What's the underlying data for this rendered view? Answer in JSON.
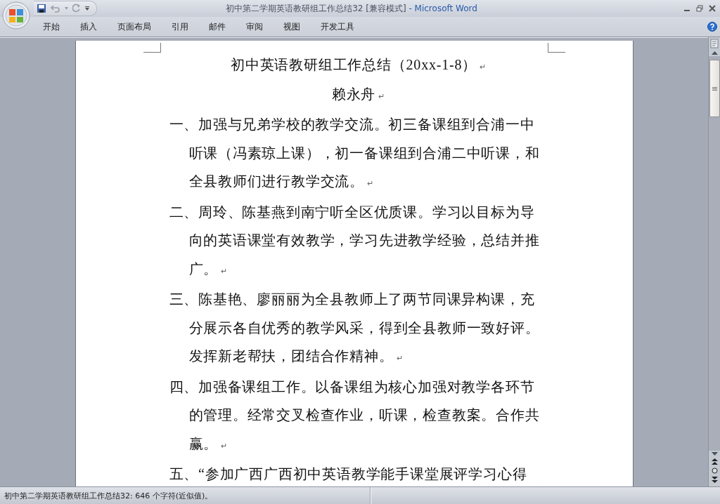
{
  "window": {
    "document_title": "初中第二学期英语教研组工作总结32 [兼容模式]",
    "separator": "-",
    "app_name": "Microsoft Word"
  },
  "ribbon": {
    "tabs": [
      "开始",
      "插入",
      "页面布局",
      "引用",
      "邮件",
      "审阅",
      "视图",
      "开发工具"
    ]
  },
  "document": {
    "title": "初中英语教研组工作总结（20xx-1-8）",
    "author": "赖永舟",
    "paragraph_mark": "↵",
    "paragraphs": [
      {
        "text": "一、加强与兄弟学校的教学交流。初三备课组到合浦一中听课（冯素琼上课），初一备课组到合浦二中听课，和全县教师们进行教学交流。",
        "end_mark": "↵"
      },
      {
        "text": "二、周玲、陈基燕到南宁听全区优质课。学习以目标为导向的英语课堂有效教学，学习先进教学经验，总结并推广。",
        "end_mark": "↵"
      },
      {
        "text": "三、陈基艳、廖丽丽为全县教师上了两节同课异构课，充分展示各自优秀的教学风采，得到全县教师一致好评。发挥新老帮扶，团结合作精神。",
        "end_mark": "↵"
      },
      {
        "text": "四、加强备课组工作。以备课组为核心加强对教学各环节的管理。经常交叉检查作业，听课，检查教案。合作共赢。",
        "end_mark": "↵"
      },
      {
        "text": "五、“参加广西广西初中英语教学能手课堂展评学习心得"
      }
    ]
  },
  "status_bar": {
    "text": "初中第二学期英语教研组工作总结32: 646 个字符(近似值)。"
  }
}
